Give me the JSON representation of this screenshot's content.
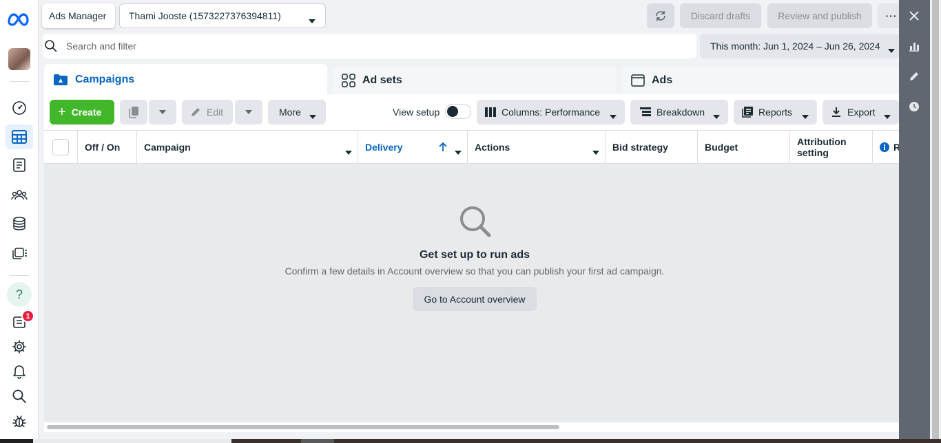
{
  "top": {
    "app_title": "Ads Manager",
    "account_selector": "Thami Jooste (1573227376394811)",
    "discard_label": "Discard drafts",
    "review_label": "Review and publish",
    "more_label": "···"
  },
  "search": {
    "placeholder": "Search and filter"
  },
  "date_range": "This month: Jun 1, 2024 – Jun 26, 2024",
  "tabs": [
    {
      "label": "Campaigns",
      "active": true
    },
    {
      "label": "Ad sets",
      "active": false
    },
    {
      "label": "Ads",
      "active": false
    }
  ],
  "toolbar": {
    "create_label": "Create",
    "edit_label": "Edit",
    "more_label": "More",
    "view_setup_label": "View setup",
    "columns_label": "Columns: Performance",
    "breakdown_label": "Breakdown",
    "reports_label": "Reports",
    "export_label": "Export"
  },
  "table": {
    "columns": [
      "Off / On",
      "Campaign",
      "Delivery",
      "Actions",
      "Bid strategy",
      "Budget",
      "Attribution setting",
      "R"
    ]
  },
  "empty_state": {
    "title": "Get set up to run ads",
    "message": "Confirm a few details in Account overview so that you can publish your first ad campaign.",
    "button_label": "Go to Account overview"
  },
  "rail": {
    "help_glyph": "?",
    "notification_count": "1"
  },
  "colors": {
    "accent_blue": "#0a66c2",
    "create_green": "#42b72a",
    "badge_red": "#e41e3f"
  }
}
